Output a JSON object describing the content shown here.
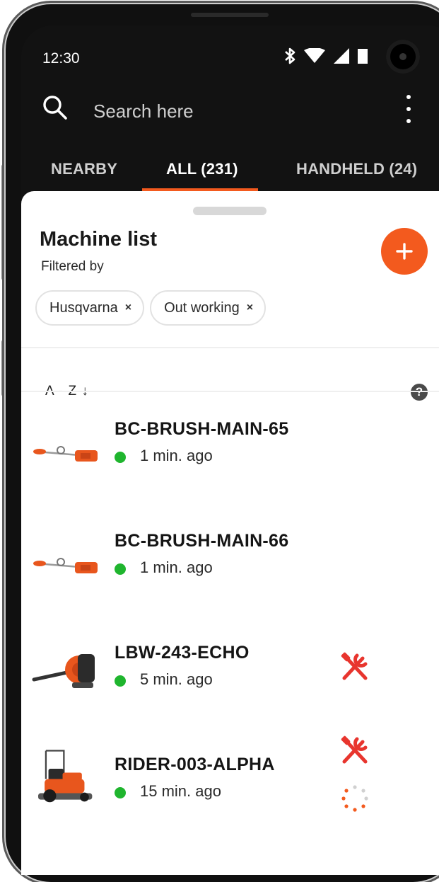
{
  "status_bar": {
    "time": "12:30"
  },
  "search": {
    "placeholder": "Search here"
  },
  "tabs": [
    {
      "label": "NEARBY"
    },
    {
      "label": "ALL (231)"
    },
    {
      "label": "HANDHELD (24)"
    }
  ],
  "sheet": {
    "title": "Machine list",
    "subtitle": "Filtered by",
    "add_button_label": "+",
    "filters": [
      {
        "label": "Husqvarna",
        "remove": "×"
      },
      {
        "label": "Out working",
        "remove": "×"
      }
    ],
    "sort_label": "A - Z ↓",
    "help": "?"
  },
  "machines": [
    {
      "name": "BC-BRUSH-MAIN-65",
      "last_seen": "1 min. ago",
      "icon": "brushcutter-icon"
    },
    {
      "name": "BC-BRUSH-MAIN-66",
      "last_seen": "1 min. ago",
      "icon": "brushcutter-icon"
    },
    {
      "name": "LBW-243-ECHO",
      "last_seen": "5 min. ago",
      "icon": "leaf-blower-icon",
      "service_needed": true
    },
    {
      "name": "RIDER-003-ALPHA",
      "last_seen": "15 min. ago",
      "icon": "rider-mower-icon",
      "service_needed": true,
      "syncing": true
    }
  ],
  "colors": {
    "accent": "#f35a1e",
    "online": "#1fb52e",
    "service": "#e8352e",
    "bar": "#121212"
  }
}
